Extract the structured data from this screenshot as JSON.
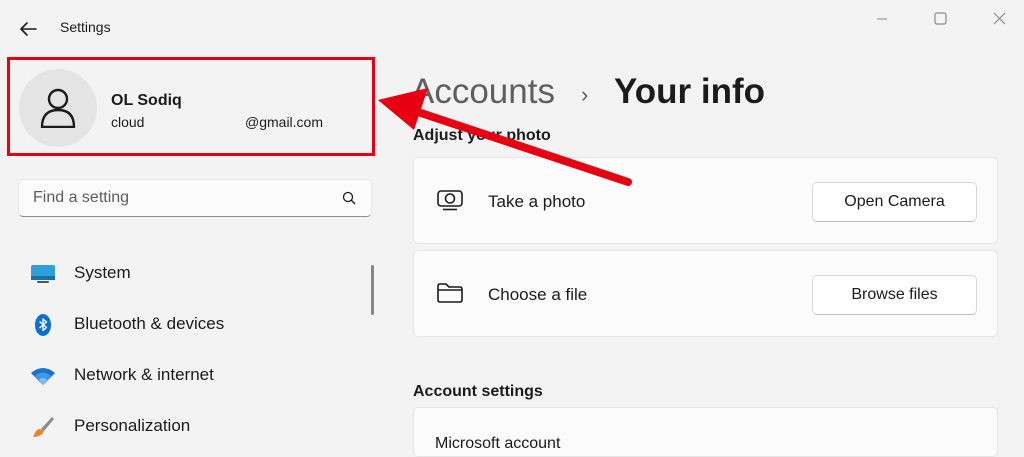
{
  "window": {
    "title": "Settings",
    "controls": [
      "minimize-icon",
      "maximize-icon",
      "close-icon"
    ]
  },
  "profile": {
    "name": "OL Sodiq",
    "email_user": "cloud",
    "email_domain": "@gmail.com",
    "highlight_color": "#e60012"
  },
  "search": {
    "placeholder": "Find a setting"
  },
  "sidebar": {
    "items": [
      {
        "label": "System",
        "icon": "system-icon"
      },
      {
        "label": "Bluetooth & devices",
        "icon": "bluetooth-icon"
      },
      {
        "label": "Network & internet",
        "icon": "wifi-icon"
      },
      {
        "label": "Personalization",
        "icon": "brush-icon"
      }
    ]
  },
  "breadcrumb": {
    "parent": "Accounts",
    "separator": "›",
    "current": "Your info"
  },
  "photo_section": {
    "title": "Adjust your photo",
    "take_photo": {
      "label": "Take a photo",
      "button": "Open Camera",
      "icon": "camera-icon"
    },
    "choose_file": {
      "label": "Choose a file",
      "button": "Browse files",
      "icon": "folder-icon"
    }
  },
  "account_settings": {
    "title": "Account settings",
    "first_item": "Microsoft account"
  },
  "annotation": {
    "arrow_color": "#e60012"
  }
}
